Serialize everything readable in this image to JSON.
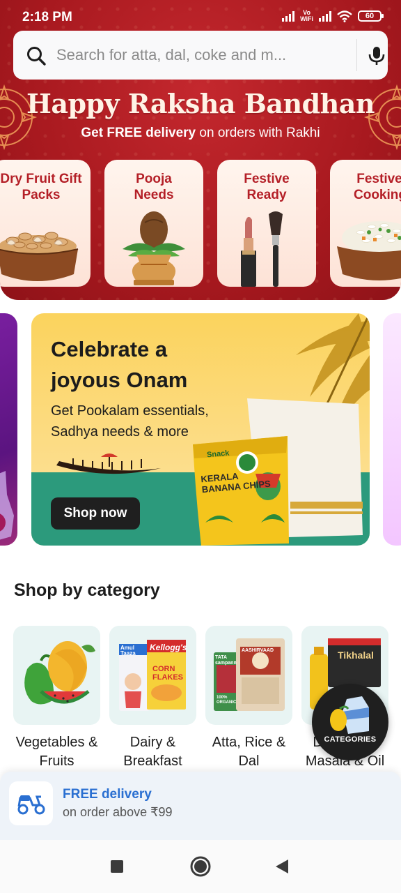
{
  "status_bar": {
    "time": "2:18 PM",
    "network_label_top": "Vo",
    "network_label_bottom": "WiFi",
    "battery": "60",
    "icons": [
      "signal-icon",
      "vowifi-icon",
      "signal-icon",
      "wifi-icon",
      "battery-icon"
    ]
  },
  "search": {
    "placeholder": "Search for atta, dal, coke and m...",
    "icon": "search-icon",
    "voice_icon": "mic-icon"
  },
  "festive_banner": {
    "title": "Happy Raksha Bandhan",
    "subtitle_bold": "Get FREE delivery",
    "subtitle_rest": " on orders with Rakhi",
    "cards": [
      {
        "label": "Dry Fruit Gift Packs"
      },
      {
        "label": "Pooja Needs"
      },
      {
        "label": "Festive Ready"
      },
      {
        "label": "Festive Cooking"
      }
    ]
  },
  "promo_banner": {
    "title_line1": "Celebrate a",
    "title_line2": "joyous Onam",
    "subtitle": "Get Pookalam essentials, Sadhya needs & more",
    "button": "Shop now",
    "pack_brand": "Snack",
    "pack_name": "KERALA BANANA CHIPS"
  },
  "categories": {
    "title": "Shop by category",
    "items": [
      {
        "label": "Vegetables & Fruits"
      },
      {
        "label": "Dairy & Breakfast"
      },
      {
        "label": "Atta, Rice & Dal"
      },
      {
        "label": "Dry Fruits, Masala & Oil"
      }
    ],
    "fab_label": "CATEGORIES",
    "product_text": {
      "amul": "Amul Taaza",
      "kelloggs": "Kellogg's",
      "corn": "CORN FLAKES",
      "tata": "TATA sampann",
      "aashirvaad": "AASHIRVAAD",
      "tikhalal": "Tikhalal",
      "organic": "100% ORGANIC"
    }
  },
  "delivery": {
    "title": "FREE delivery",
    "subtitle": "on order above ₹99"
  },
  "colors": {
    "festive_red": "#a8191f",
    "festive_label": "#b41f27",
    "delivery_blue": "#2a6fd1",
    "onam_yellow": "#fbd35d",
    "onam_green": "#2c9a7c"
  }
}
